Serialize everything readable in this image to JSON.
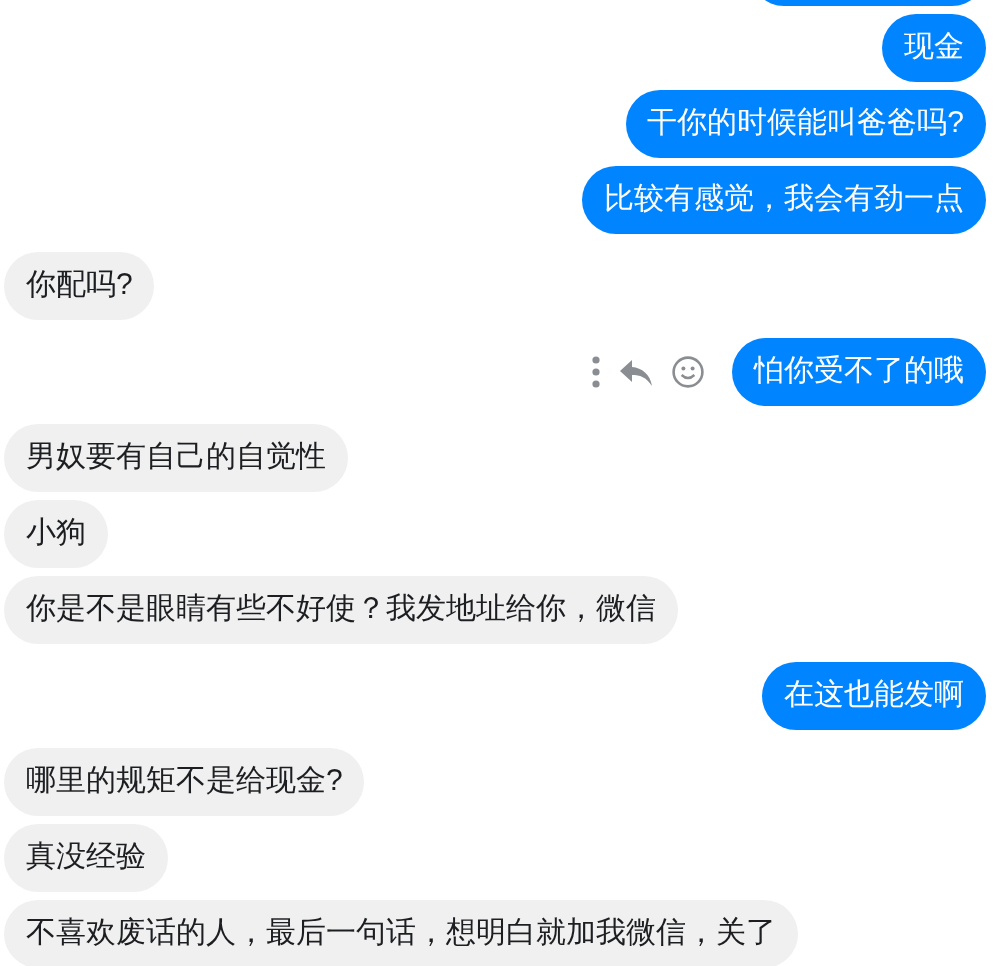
{
  "messages": [
    {
      "kind": "sent",
      "text": "现金",
      "hovered": false
    },
    {
      "kind": "sent",
      "text": "干你的时候能叫爸爸吗?",
      "hovered": false
    },
    {
      "kind": "sent",
      "text": "比较有感觉，我会有劲一点",
      "hovered": false
    },
    {
      "kind": "received",
      "text": "你配吗?",
      "hovered": false
    },
    {
      "kind": "sent",
      "text": "怕你受不了的哦",
      "hovered": true
    },
    {
      "kind": "received",
      "text": "男奴要有自己的自觉性",
      "hovered": false
    },
    {
      "kind": "received",
      "text": "小狗",
      "hovered": false
    },
    {
      "kind": "received",
      "text": "你是不是眼睛有些不好使？我发地址给你，微信",
      "hovered": false
    },
    {
      "kind": "sent",
      "text": "在这也能发啊",
      "hovered": false
    },
    {
      "kind": "received",
      "text": "哪里的规矩不是给现金?",
      "hovered": false
    },
    {
      "kind": "received",
      "text": "真没经验",
      "hovered": false
    },
    {
      "kind": "received",
      "text": "不喜欢废话的人，最后一句话，想明白就加我微信，关了",
      "hovered": false
    }
  ]
}
